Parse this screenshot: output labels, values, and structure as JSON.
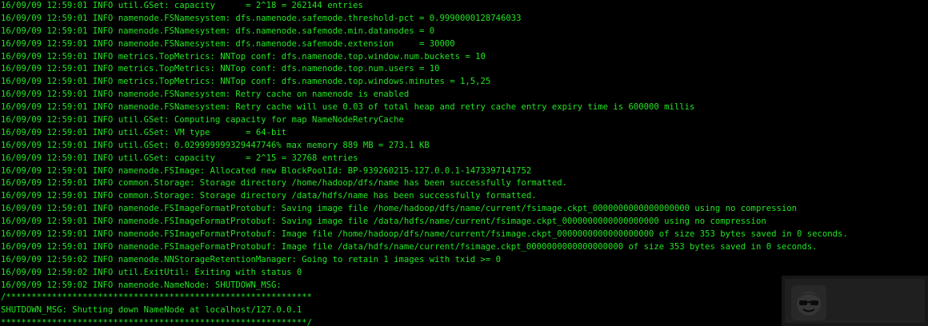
{
  "terminal": {
    "lines": [
      "16/09/09 12:59:01 INFO util.GSet: capacity      = 2^18 = 262144 entries",
      "16/09/09 12:59:01 INFO namenode.FSNamesystem: dfs.namenode.safemode.threshold-pct = 0.9990000128746033",
      "16/09/09 12:59:01 INFO namenode.FSNamesystem: dfs.namenode.safemode.min.datanodes = 0",
      "16/09/09 12:59:01 INFO namenode.FSNamesystem: dfs.namenode.safemode.extension     = 30000",
      "16/09/09 12:59:01 INFO metrics.TopMetrics: NNTop conf: dfs.namenode.top.window.num.buckets = 10",
      "16/09/09 12:59:01 INFO metrics.TopMetrics: NNTop conf: dfs.namenode.top.num.users = 10",
      "16/09/09 12:59:01 INFO metrics.TopMetrics: NNTop conf: dfs.namenode.top.windows.minutes = 1,5,25",
      "16/09/09 12:59:01 INFO namenode.FSNamesystem: Retry cache on namenode is enabled",
      "16/09/09 12:59:01 INFO namenode.FSNamesystem: Retry cache will use 0.03 of total heap and retry cache entry expiry time is 600000 millis",
      "16/09/09 12:59:01 INFO util.GSet: Computing capacity for map NameNodeRetryCache",
      "16/09/09 12:59:01 INFO util.GSet: VM type       = 64-bit",
      "16/09/09 12:59:01 INFO util.GSet: 0.029999999329447746% max memory 889 MB = 273.1 KB",
      "16/09/09 12:59:01 INFO util.GSet: capacity      = 2^15 = 32768 entries",
      "16/09/09 12:59:01 INFO namenode.FSImage: Allocated new BlockPoolId: BP-939260215-127.0.0.1-1473397141752",
      "16/09/09 12:59:01 INFO common.Storage: Storage directory /home/hadoop/dfs/name has been successfully formatted.",
      "16/09/09 12:59:01 INFO common.Storage: Storage directory /data/hdfs/name has been successfully formatted.",
      "16/09/09 12:59:01 INFO namenode.FSImageFormatProtobuf: Saving image file /home/hadoop/dfs/name/current/fsimage.ckpt_0000000000000000000 using no compression",
      "16/09/09 12:59:01 INFO namenode.FSImageFormatProtobuf: Saving image file /data/hdfs/name/current/fsimage.ckpt_0000000000000000000 using no compression",
      "16/09/09 12:59:01 INFO namenode.FSImageFormatProtobuf: Image file /home/hadoop/dfs/name/current/fsimage.ckpt_0000000000000000000 of size 353 bytes saved in 0 seconds.",
      "16/09/09 12:59:01 INFO namenode.FSImageFormatProtobuf: Image file /data/hdfs/name/current/fsimage.ckpt_0000000000000000000 of size 353 bytes saved in 0 seconds.",
      "16/09/09 12:59:02 INFO namenode.NNStorageRetentionManager: Going to retain 1 images with txid >= 0",
      "16/09/09 12:59:02 INFO util.ExitUtil: Exiting with status 0",
      "16/09/09 12:59:02 INFO namenode.NameNode: SHUTDOWN_MSG:",
      "/************************************************************",
      "SHUTDOWN_MSG: Shutting down NameNode at localhost/127.0.0.1",
      "************************************************************/"
    ],
    "text_color": "#23e323",
    "background_color": "#000000"
  },
  "watermark": {
    "icon": "sunglasses-face-logo-icon"
  }
}
